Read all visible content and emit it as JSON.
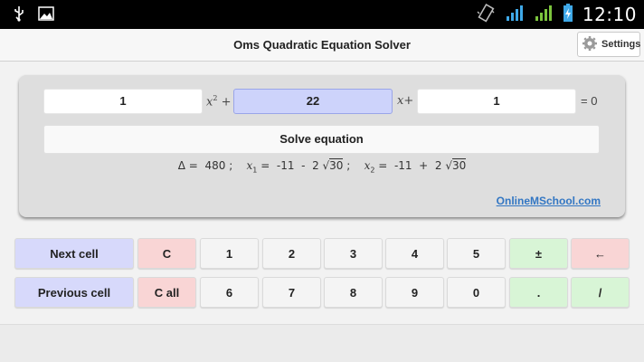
{
  "status_bar": {
    "time": "12:10",
    "icons": [
      "usb-icon",
      "image-icon",
      "vibrate-icon",
      "wifi-signal-icon",
      "cell-signal-icon",
      "battery-charging-icon"
    ]
  },
  "header": {
    "title": "Oms Quadratic Equation Solver",
    "settings_label": "Settings"
  },
  "equation": {
    "a": "1",
    "b": "22",
    "c": "1",
    "x2_term": "x",
    "x2_power": "2",
    "x2_plus": " +",
    "x_term": "x",
    "x_plus": "+",
    "equals_zero": "= 0",
    "solve_label": "Solve equation"
  },
  "result": {
    "delta_symbol": "Δ",
    "eq1": " =  ",
    "delta_value": "480",
    "sep": " ;    ",
    "x_var": "x",
    "x1_sub": "1",
    "x2_sub": "2",
    "eq2": " =  ",
    "x1_prefix": "-11  -  2 √",
    "x1_radicand": "30",
    "x2_prefix": "-11  +  2 √",
    "x2_radicand": "30"
  },
  "link": {
    "label": "OnlineMSchool.com"
  },
  "keypad": {
    "row1": [
      "Next cell",
      "C",
      "1",
      "2",
      "3",
      "4",
      "5",
      "±",
      "←"
    ],
    "row2": [
      "Previous cell",
      "C all",
      "6",
      "7",
      "8",
      "9",
      "0",
      ".",
      "/"
    ]
  },
  "colors": {
    "active_cell": "#cdd3fb",
    "nav_key": "#d7d9fb",
    "clear_key": "#f9d5d5",
    "op_key": "#d8f5d6",
    "link": "#3276c3"
  }
}
